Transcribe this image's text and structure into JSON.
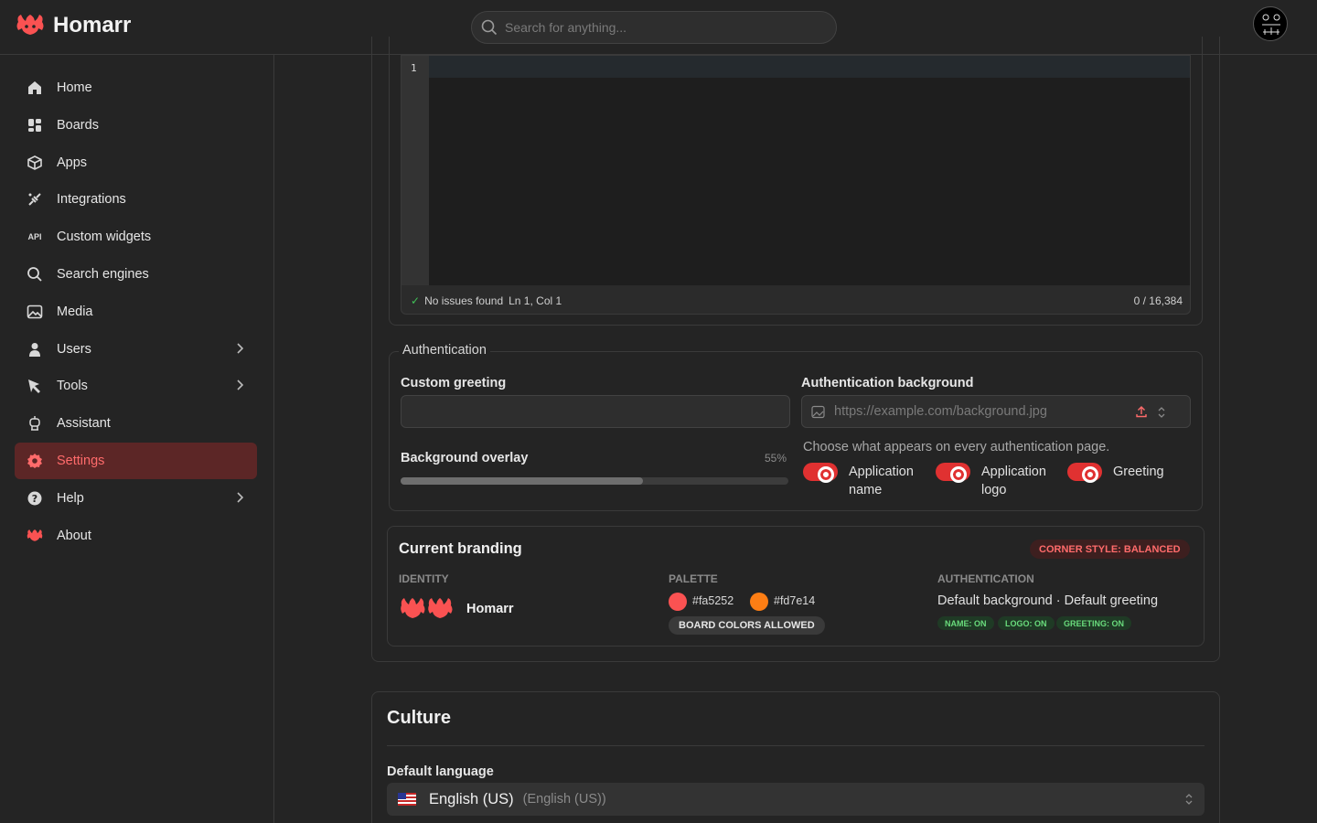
{
  "app": {
    "title": "Homarr"
  },
  "search": {
    "placeholder": "Search for anything..."
  },
  "sidebar": {
    "items": [
      {
        "label": "Home",
        "icon": "home-icon"
      },
      {
        "label": "Boards",
        "icon": "grid-icon"
      },
      {
        "label": "Apps",
        "icon": "box-icon"
      },
      {
        "label": "Integrations",
        "icon": "plug-icon"
      },
      {
        "label": "Custom widgets",
        "icon": "api-icon"
      },
      {
        "label": "Search engines",
        "icon": "search-icon"
      },
      {
        "label": "Media",
        "icon": "image-icon"
      },
      {
        "label": "Users",
        "icon": "user-icon",
        "chevron": true
      },
      {
        "label": "Tools",
        "icon": "pointer-icon",
        "chevron": true
      },
      {
        "label": "Assistant",
        "icon": "robot-icon"
      },
      {
        "label": "Settings",
        "icon": "gear-icon",
        "active": true
      },
      {
        "label": "Help",
        "icon": "question-icon",
        "chevron": true
      },
      {
        "label": "About",
        "icon": "logo-icon"
      }
    ]
  },
  "editor": {
    "line_number": "1",
    "status": "No issues found",
    "cursor": "Ln 1, Col 1",
    "char_count": "0 / 16,384"
  },
  "authentication": {
    "legend": "Authentication",
    "custom_greeting_label": "Custom greeting",
    "custom_greeting_value": "",
    "background_label": "Authentication background",
    "background_placeholder": "https://example.com/background.jpg",
    "overlay_label": "Background overlay",
    "overlay_value_text": "55%",
    "overlay_value": 0.55,
    "toggles_caption": "Choose what appears on every authentication page.",
    "toggles": [
      {
        "line1": "Application",
        "line2": "name",
        "on": true
      },
      {
        "line1": "Application",
        "line2": "logo",
        "on": true
      },
      {
        "line1": "Greeting",
        "line2": "",
        "on": true
      }
    ]
  },
  "branding": {
    "title": "Current branding",
    "corner_badge": "CORNER STYLE: BALANCED",
    "identity_head": "IDENTITY",
    "identity_name": "Homarr",
    "palette_head": "PALETTE",
    "primary_color": "#fa5252",
    "secondary_color": "#fd7e14",
    "board_colors": "BOARD COLORS ALLOWED",
    "auth_head": "AUTHENTICATION",
    "auth_summary": "Default background · Default greeting",
    "auth_pills": [
      "NAME: ON",
      "LOGO: ON",
      "GREETING: ON"
    ]
  },
  "culture": {
    "title": "Culture",
    "language_label": "Default language",
    "language_value": "English (US)",
    "language_native": "(English (US))"
  },
  "colors": {
    "accent": "#fa5252",
    "active_bg": "#5c2626",
    "background": "#242424"
  }
}
